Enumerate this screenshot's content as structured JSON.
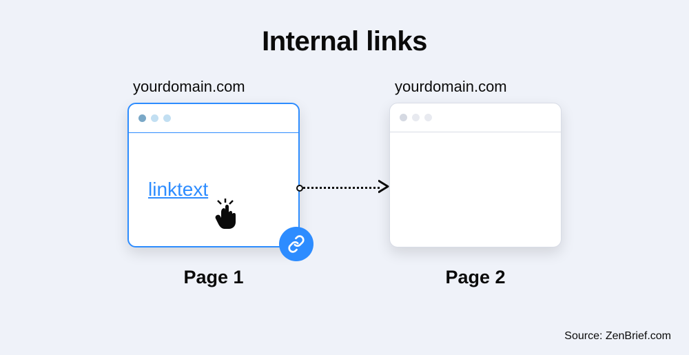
{
  "title": "Internal links",
  "page1": {
    "domain": "yourdomain.com",
    "link_text": "linktext",
    "label": "Page 1"
  },
  "page2": {
    "domain": "yourdomain.com",
    "label": "Page 2"
  },
  "source": "Source: ZenBrief.com"
}
